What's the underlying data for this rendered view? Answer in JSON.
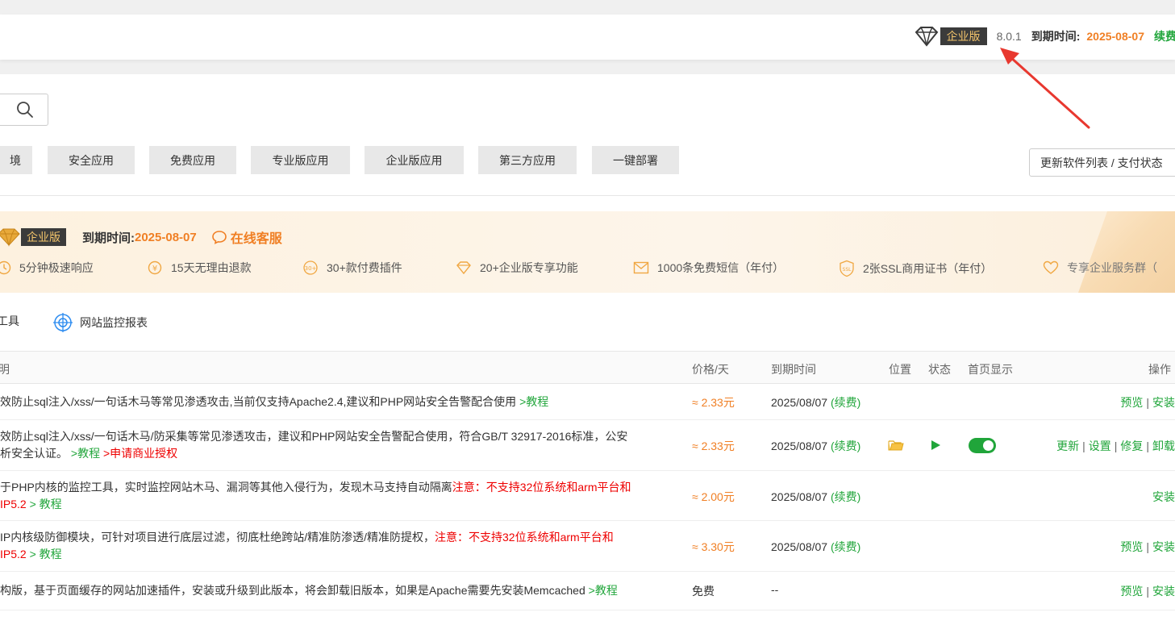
{
  "header": {
    "edition_badge": "企业版",
    "version": "8.0.1",
    "expire_label": "到期时间:",
    "expire_date": "2025-08-07",
    "renew_label": "续费"
  },
  "categories": [
    "境",
    "安全应用",
    "免费应用",
    "专业版应用",
    "企业版应用",
    "第三方应用",
    "一键部署"
  ],
  "refresh_button": "更新软件列表 / 支付状态",
  "banner": {
    "badge": "企业版",
    "expire_label": "到期时间:",
    "expire_date": "2025-08-07",
    "service_label": "在线客服",
    "features": [
      {
        "icon": "clock-icon",
        "text": "5分钟极速响应"
      },
      {
        "icon": "refund-icon",
        "text": "15天无理由退款"
      },
      {
        "icon": "plugin-30-icon",
        "text": "30+款付费插件"
      },
      {
        "icon": "diamond-icon",
        "text": "20+企业版专享功能"
      },
      {
        "icon": "mail-icon",
        "text": "1000条免费短信（年付）"
      },
      {
        "icon": "ssl-icon",
        "text": "2张SSL商用证书（年付）"
      },
      {
        "icon": "heart-icon",
        "text": "专享企业服务群（"
      }
    ]
  },
  "tools": [
    {
      "icon": "",
      "text": "工具"
    },
    {
      "icon": "target-icon",
      "text": "网站监控报表"
    }
  ],
  "table": {
    "headers": {
      "desc": "明",
      "price": "价格/天",
      "expire": "到期时间",
      "location": "位置",
      "status": "状态",
      "homepage": "首页显示",
      "ops": "操作"
    },
    "rows": [
      {
        "desc_line1": "效防止sql注入/xss/一句话木马等常见渗透攻击,当前仅支持Apache2.4,建议和PHP网站安全告警配合使用",
        "desc_link1": " >教程",
        "price": "≈ 2.33元",
        "expire": "2025/08/07",
        "renew": "(续费)",
        "ops": [
          "预览",
          "安装"
        ]
      },
      {
        "desc_line1": "效防止sql注入/xss/一句话木马/防采集等常见渗透攻击，建议和PHP网站安全告警配合使用，符合GB/T 32917-2016标准，公安",
        "desc_line2": "析安全认证。",
        "desc_link1": " >教程",
        "desc_link2": " >申请商业授权",
        "price": "≈ 2.33元",
        "expire": "2025/08/07",
        "renew": "(续费)",
        "ops": [
          "更新",
          "设置",
          "修复",
          "卸载"
        ]
      },
      {
        "desc_line1": "于PHP内核的监控工具，实时监控网站木马、漏洞等其他入侵行为，发现木马支持自动隔离",
        "desc_warn1": "注意：不支持32位系统和arm平台和",
        "desc_warn2": "IP5.2",
        "desc_link1": " > 教程",
        "price": "≈ 2.00元",
        "expire": "2025/08/07",
        "renew": "(续费)",
        "ops": [
          "安装"
        ]
      },
      {
        "desc_line1": "IP内核级防御模块，可针对项目进行底层过滤，彻底杜绝跨站/精准防渗透/精准防提权，",
        "desc_warn1": "注意：不支持32位系统和arm平台和",
        "desc_warn2": "IP5.2",
        "desc_link1": " > 教程",
        "price": "≈ 3.30元",
        "expire": "2025/08/07",
        "renew": "(续费)",
        "ops": [
          "预览",
          "安装"
        ]
      },
      {
        "desc_line1": "构版，基于页面缓存的网站加速插件，安装或升级到此版本，将会卸载旧版本，如果是Apache需要先安装Memcached",
        "desc_link1": " >教程",
        "price": "免费",
        "expire": "--",
        "ops": [
          "预览",
          "安装"
        ]
      }
    ]
  },
  "colors": {
    "accent_green": "#20a53a",
    "accent_orange": "#f07f24",
    "warning_red": "#e00000",
    "arrow_red": "#e8382f"
  }
}
